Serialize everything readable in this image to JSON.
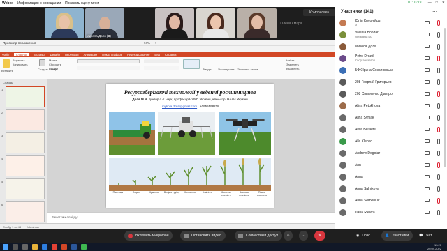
{
  "titlebar": {
    "app": "Webex",
    "meeting_info": "Информация о совещании",
    "show_stage": "Показать сцену мини",
    "timer": "01:03:19"
  },
  "video": {
    "tiles": [
      {
        "name": ""
      },
      {
        "name": "Микола Доля (Д)"
      },
      {
        "name": ""
      },
      {
        "name": ""
      },
      {
        "name": ""
      }
    ],
    "olena": "Олена Кмара",
    "layout_button": "Компоновка"
  },
  "ppt": {
    "window_title": "Просмотр приложения",
    "zoom": "74%",
    "tabs": [
      "Файл",
      "Главная",
      "Вставка",
      "Дизайн",
      "Переходы",
      "Анимация",
      "Показ слайдов",
      "Рецензирование",
      "Вид",
      "Справка"
    ],
    "active_tab": "Главная",
    "ribbon": {
      "paste": "Вставить",
      "cut": "Вырезать",
      "copy": "Копировать",
      "new_slide": "Создать слайд",
      "layout": "Макет",
      "reset": "Сбросить",
      "section": "Раздел",
      "shapes": "Фигуры",
      "arrange": "Упорядочить",
      "quick_styles": "Экспресс-стили",
      "find": "Найти",
      "replace": "Заменить",
      "select": "Выделить"
    },
    "thumbs_label": "Слайды",
    "slide_numbers": [
      "1",
      "2",
      "3",
      "4",
      "5",
      "6"
    ],
    "slide": {
      "title": "Ресурсозберігаючі технології у веденні рослинництва",
      "author_bold": "Доля М.М.",
      "author_rest": " доктор с.-г. наук, професор НУБіП України, член-кор. НААН України",
      "email": "mykola.dolia@gmail.com",
      "phone": "+0955598218",
      "stages": [
        "Пшениця",
        "Сходи",
        "Кущіння",
        "Вихід в трубку",
        "Колосіння",
        "Цвітіння",
        "Молочна стиглість",
        "Воскова стиглість",
        "Повна стиглість"
      ]
    },
    "notes": "Заметки к слайду",
    "status": "Слайд 1 из 44",
    "status_lang": "Ukrainian"
  },
  "controls": {
    "mic": "Включить микрофон",
    "video": "Остановить видео",
    "share": "Совместный доступ",
    "chat_label": "Прис.",
    "participants_label": "Участники",
    "chat": "Чат"
  },
  "panel": {
    "title": "Участники (141)",
    "participants": [
      {
        "name": "Юлія Колонійць",
        "role": "Я",
        "avatar": "#c47a52"
      },
      {
        "name": "Valeriia Bondar",
        "role": "Организатор",
        "avatar": "#7a8f3a"
      },
      {
        "name": "Микола Доля",
        "role": "",
        "avatar": "#8a5a3a"
      },
      {
        "name": "Petro Drozd",
        "role": "Соорганизатор",
        "avatar": "#6b4b8a"
      },
      {
        "name": "БФК Ірина Соколовська",
        "role": "",
        "avatar": "#3b6fb6"
      },
      {
        "name": "208 Георгий Григорьев",
        "role": "",
        "avatar": "#5a5a5a"
      },
      {
        "name": "208 Сиволенко Дмитро",
        "role": "",
        "avatar": "#5a5a5a"
      },
      {
        "name": "Alina Petukhova",
        "role": "",
        "avatar": "#9c6b4a"
      },
      {
        "name": "Alina Syniak",
        "role": "",
        "avatar": "#6a6a6a"
      },
      {
        "name": "Alisa Belskite",
        "role": "",
        "avatar": "#6a6a6a"
      },
      {
        "name": "Alla Klepko",
        "role": "",
        "avatar": "#3a9a4a"
      },
      {
        "name": "Andrew Dogotar",
        "role": "",
        "avatar": "#6a6a6a"
      },
      {
        "name": "Ann",
        "role": "",
        "avatar": "#6a6a6a"
      },
      {
        "name": "Anna",
        "role": "",
        "avatar": "#6a6a6a"
      },
      {
        "name": "Anna Salnikova",
        "role": "",
        "avatar": "#6a6a6a"
      },
      {
        "name": "Anna Serbeniuk",
        "role": "",
        "avatar": "#6a6a6a"
      },
      {
        "name": "Daria Rievka",
        "role": "",
        "avatar": "#6a6a6a"
      }
    ]
  },
  "taskbar": {
    "time": "13:20",
    "date": "20.04.2022"
  }
}
